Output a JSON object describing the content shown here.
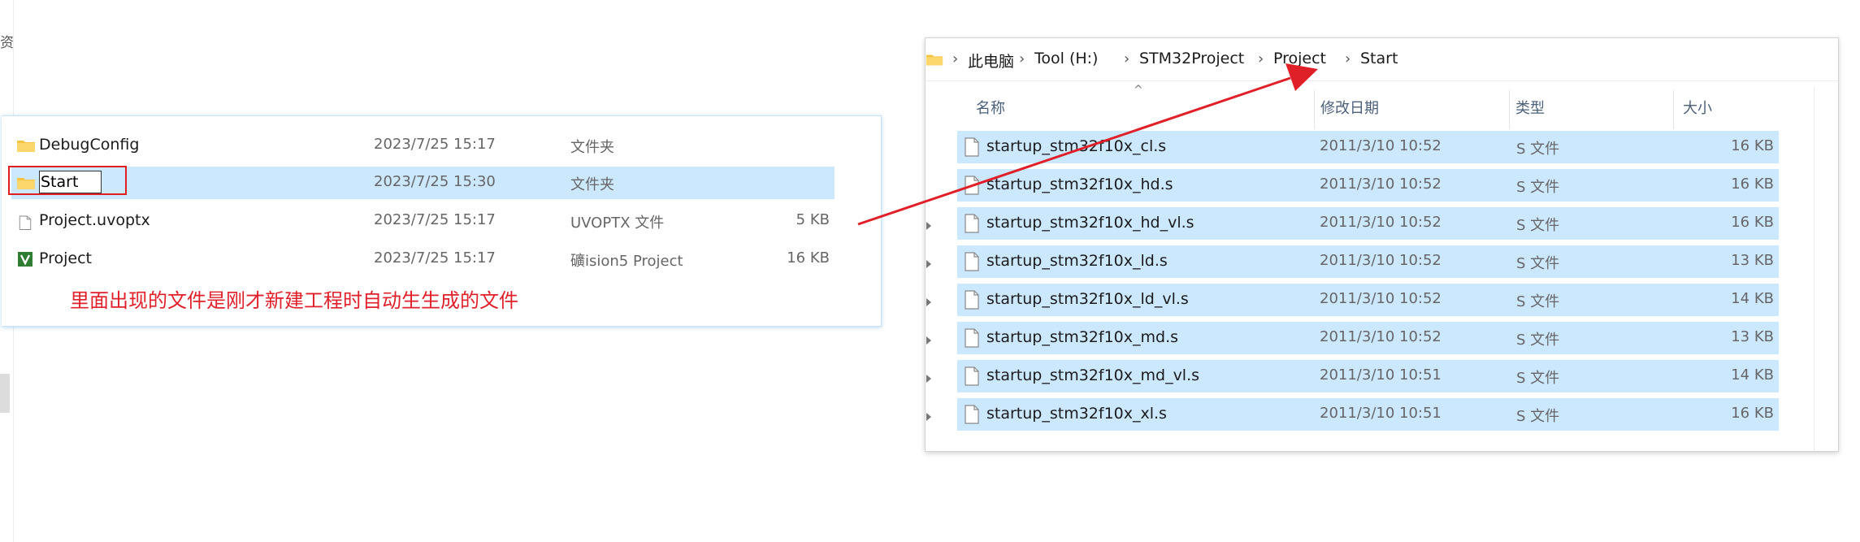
{
  "edge": {
    "glyph": "资"
  },
  "left_panel": {
    "rows": [
      {
        "name": "DebugConfig",
        "date": "2023/7/25 15:17",
        "type": "文件夹",
        "size": "",
        "icon": "folder-icon"
      },
      {
        "name": "Start",
        "date": "2023/7/25 15:30",
        "type": "文件夹",
        "size": "",
        "icon": "folder-icon",
        "selected": true,
        "renaming": true
      },
      {
        "name": "Project.uvoptx",
        "date": "2023/7/25 15:17",
        "type": "UVOPTX 文件",
        "size": "5 KB",
        "icon": "file-icon"
      },
      {
        "name": "Project",
        "date": "2023/7/25 15:17",
        "type": "礦ision5 Project",
        "size": "16 KB",
        "icon": "keil-project-icon"
      }
    ],
    "annotation": "里面出现的文件是刚才新建工程时自动生生成的文件",
    "annotation_color": "#e0202a"
  },
  "right_panel": {
    "breadcrumb": [
      "此电脑",
      "Tool (H:)",
      "STM32Project",
      "Project",
      "Start"
    ],
    "headers": {
      "name": "名称",
      "date": "修改日期",
      "type": "类型",
      "size": "大小"
    },
    "rows": [
      {
        "name": "startup_stm32f10x_cl.s",
        "date": "2011/3/10 10:52",
        "type": "S 文件",
        "size": "16 KB"
      },
      {
        "name": "startup_stm32f10x_hd.s",
        "date": "2011/3/10 10:52",
        "type": "S 文件",
        "size": "16 KB"
      },
      {
        "name": "startup_stm32f10x_hd_vl.s",
        "date": "2011/3/10 10:52",
        "type": "S 文件",
        "size": "16 KB"
      },
      {
        "name": "startup_stm32f10x_ld.s",
        "date": "2011/3/10 10:52",
        "type": "S 文件",
        "size": "13 KB"
      },
      {
        "name": "startup_stm32f10x_ld_vl.s",
        "date": "2011/3/10 10:52",
        "type": "S 文件",
        "size": "14 KB"
      },
      {
        "name": "startup_stm32f10x_md.s",
        "date": "2011/3/10 10:52",
        "type": "S 文件",
        "size": "13 KB"
      },
      {
        "name": "startup_stm32f10x_md_vl.s",
        "date": "2011/3/10 10:51",
        "type": "S 文件",
        "size": "14 KB"
      },
      {
        "name": "startup_stm32f10x_xl.s",
        "date": "2011/3/10 10:51",
        "type": "S 文件",
        "size": "16 KB"
      }
    ],
    "selection_color": "#cce8ff"
  },
  "arrow_color": "#e02028"
}
